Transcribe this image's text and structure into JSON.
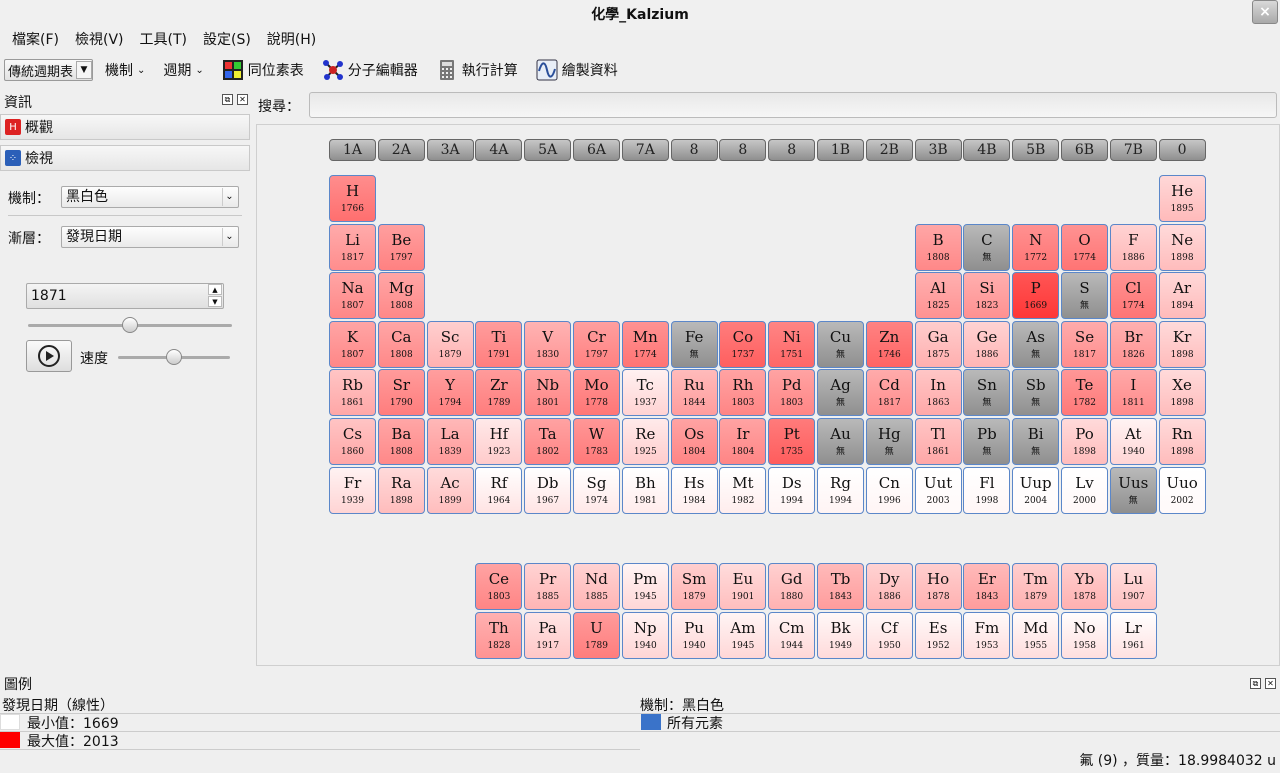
{
  "window": {
    "title": "化學_Kalzium",
    "close_glyph": "×"
  },
  "menu": [
    "檔案(F)",
    "檢視(V)",
    "工具(T)",
    "設定(S)",
    "說明(H)"
  ],
  "toolbar": {
    "table_type": "傳統週期表",
    "scheme": "機制",
    "period": "週期",
    "isotopes": "同位素表",
    "molecule_editor": "分子編輯器",
    "calculator": "執行計算",
    "plot": "繪製資料"
  },
  "info_panel": {
    "title": "資訊",
    "overview": "概觀",
    "view": "檢視",
    "scheme_label": "機制：",
    "scheme_value": "黑白色",
    "gradient_label": "漸層：",
    "gradient_value": "發現日期",
    "year_value": "1871",
    "year_slider_fraction": 0.5,
    "speed_label": "速度",
    "speed_slider_fraction": 0.5
  },
  "search": {
    "label": "搜尋：",
    "value": ""
  },
  "group_headers": [
    "1A",
    "2A",
    "3A",
    "4A",
    "5A",
    "6A",
    "7A",
    "8",
    "8",
    "8",
    "1B",
    "2B",
    "3B",
    "4B",
    "5B",
    "6B",
    "7B",
    "0"
  ],
  "elements": [
    {
      "s": "H",
      "y": "1766",
      "c": 1,
      "r": 1,
      "k": "r"
    },
    {
      "s": "He",
      "y": "1895",
      "c": 18,
      "r": 1,
      "k": "r"
    },
    {
      "s": "Li",
      "y": "1817",
      "c": 1,
      "r": 2,
      "k": "r"
    },
    {
      "s": "Be",
      "y": "1797",
      "c": 2,
      "r": 2,
      "k": "r"
    },
    {
      "s": "B",
      "y": "1808",
      "c": 13,
      "r": 2,
      "k": "r"
    },
    {
      "s": "C",
      "y": "無",
      "c": 14,
      "r": 2,
      "k": "g"
    },
    {
      "s": "N",
      "y": "1772",
      "c": 15,
      "r": 2,
      "k": "r"
    },
    {
      "s": "O",
      "y": "1774",
      "c": 16,
      "r": 2,
      "k": "r"
    },
    {
      "s": "F",
      "y": "1886",
      "c": 17,
      "r": 2,
      "k": "r"
    },
    {
      "s": "Ne",
      "y": "1898",
      "c": 18,
      "r": 2,
      "k": "r"
    },
    {
      "s": "Na",
      "y": "1807",
      "c": 1,
      "r": 3,
      "k": "r"
    },
    {
      "s": "Mg",
      "y": "1808",
      "c": 2,
      "r": 3,
      "k": "r"
    },
    {
      "s": "Al",
      "y": "1825",
      "c": 13,
      "r": 3,
      "k": "r"
    },
    {
      "s": "Si",
      "y": "1823",
      "c": 14,
      "r": 3,
      "k": "r"
    },
    {
      "s": "P",
      "y": "1669",
      "c": 15,
      "r": 3,
      "k": "r"
    },
    {
      "s": "S",
      "y": "無",
      "c": 16,
      "r": 3,
      "k": "g"
    },
    {
      "s": "Cl",
      "y": "1774",
      "c": 17,
      "r": 3,
      "k": "r"
    },
    {
      "s": "Ar",
      "y": "1894",
      "c": 18,
      "r": 3,
      "k": "r"
    },
    {
      "s": "K",
      "y": "1807",
      "c": 1,
      "r": 4,
      "k": "r"
    },
    {
      "s": "Ca",
      "y": "1808",
      "c": 2,
      "r": 4,
      "k": "r"
    },
    {
      "s": "Sc",
      "y": "1879",
      "c": 3,
      "r": 4,
      "k": "r"
    },
    {
      "s": "Ti",
      "y": "1791",
      "c": 4,
      "r": 4,
      "k": "r"
    },
    {
      "s": "V",
      "y": "1830",
      "c": 5,
      "r": 4,
      "k": "r"
    },
    {
      "s": "Cr",
      "y": "1797",
      "c": 6,
      "r": 4,
      "k": "r"
    },
    {
      "s": "Mn",
      "y": "1774",
      "c": 7,
      "r": 4,
      "k": "r"
    },
    {
      "s": "Fe",
      "y": "無",
      "c": 8,
      "r": 4,
      "k": "g"
    },
    {
      "s": "Co",
      "y": "1737",
      "c": 9,
      "r": 4,
      "k": "r"
    },
    {
      "s": "Ni",
      "y": "1751",
      "c": 10,
      "r": 4,
      "k": "r"
    },
    {
      "s": "Cu",
      "y": "無",
      "c": 11,
      "r": 4,
      "k": "g"
    },
    {
      "s": "Zn",
      "y": "1746",
      "c": 12,
      "r": 4,
      "k": "r"
    },
    {
      "s": "Ga",
      "y": "1875",
      "c": 13,
      "r": 4,
      "k": "r"
    },
    {
      "s": "Ge",
      "y": "1886",
      "c": 14,
      "r": 4,
      "k": "r"
    },
    {
      "s": "As",
      "y": "無",
      "c": 15,
      "r": 4,
      "k": "g"
    },
    {
      "s": "Se",
      "y": "1817",
      "c": 16,
      "r": 4,
      "k": "r"
    },
    {
      "s": "Br",
      "y": "1826",
      "c": 17,
      "r": 4,
      "k": "r"
    },
    {
      "s": "Kr",
      "y": "1898",
      "c": 18,
      "r": 4,
      "k": "r"
    },
    {
      "s": "Rb",
      "y": "1861",
      "c": 1,
      "r": 5,
      "k": "r"
    },
    {
      "s": "Sr",
      "y": "1790",
      "c": 2,
      "r": 5,
      "k": "r"
    },
    {
      "s": "Y",
      "y": "1794",
      "c": 3,
      "r": 5,
      "k": "r"
    },
    {
      "s": "Zr",
      "y": "1789",
      "c": 4,
      "r": 5,
      "k": "r"
    },
    {
      "s": "Nb",
      "y": "1801",
      "c": 5,
      "r": 5,
      "k": "r"
    },
    {
      "s": "Mo",
      "y": "1778",
      "c": 6,
      "r": 5,
      "k": "r"
    },
    {
      "s": "Tc",
      "y": "1937",
      "c": 7,
      "r": 5,
      "k": "r"
    },
    {
      "s": "Ru",
      "y": "1844",
      "c": 8,
      "r": 5,
      "k": "r"
    },
    {
      "s": "Rh",
      "y": "1803",
      "c": 9,
      "r": 5,
      "k": "r"
    },
    {
      "s": "Pd",
      "y": "1803",
      "c": 10,
      "r": 5,
      "k": "r"
    },
    {
      "s": "Ag",
      "y": "無",
      "c": 11,
      "r": 5,
      "k": "g"
    },
    {
      "s": "Cd",
      "y": "1817",
      "c": 12,
      "r": 5,
      "k": "r"
    },
    {
      "s": "In",
      "y": "1863",
      "c": 13,
      "r": 5,
      "k": "r"
    },
    {
      "s": "Sn",
      "y": "無",
      "c": 14,
      "r": 5,
      "k": "g"
    },
    {
      "s": "Sb",
      "y": "無",
      "c": 15,
      "r": 5,
      "k": "g"
    },
    {
      "s": "Te",
      "y": "1782",
      "c": 16,
      "r": 5,
      "k": "r"
    },
    {
      "s": "I",
      "y": "1811",
      "c": 17,
      "r": 5,
      "k": "r"
    },
    {
      "s": "Xe",
      "y": "1898",
      "c": 18,
      "r": 5,
      "k": "r"
    },
    {
      "s": "Cs",
      "y": "1860",
      "c": 1,
      "r": 6,
      "k": "r"
    },
    {
      "s": "Ba",
      "y": "1808",
      "c": 2,
      "r": 6,
      "k": "r"
    },
    {
      "s": "La",
      "y": "1839",
      "c": 3,
      "r": 6,
      "k": "r"
    },
    {
      "s": "Hf",
      "y": "1923",
      "c": 4,
      "r": 6,
      "k": "r"
    },
    {
      "s": "Ta",
      "y": "1802",
      "c": 5,
      "r": 6,
      "k": "r"
    },
    {
      "s": "W",
      "y": "1783",
      "c": 6,
      "r": 6,
      "k": "r"
    },
    {
      "s": "Re",
      "y": "1925",
      "c": 7,
      "r": 6,
      "k": "r"
    },
    {
      "s": "Os",
      "y": "1804",
      "c": 8,
      "r": 6,
      "k": "r"
    },
    {
      "s": "Ir",
      "y": "1804",
      "c": 9,
      "r": 6,
      "k": "r"
    },
    {
      "s": "Pt",
      "y": "1735",
      "c": 10,
      "r": 6,
      "k": "r"
    },
    {
      "s": "Au",
      "y": "無",
      "c": 11,
      "r": 6,
      "k": "g"
    },
    {
      "s": "Hg",
      "y": "無",
      "c": 12,
      "r": 6,
      "k": "g"
    },
    {
      "s": "Tl",
      "y": "1861",
      "c": 13,
      "r": 6,
      "k": "r"
    },
    {
      "s": "Pb",
      "y": "無",
      "c": 14,
      "r": 6,
      "k": "g"
    },
    {
      "s": "Bi",
      "y": "無",
      "c": 15,
      "r": 6,
      "k": "g"
    },
    {
      "s": "Po",
      "y": "1898",
      "c": 16,
      "r": 6,
      "k": "r"
    },
    {
      "s": "At",
      "y": "1940",
      "c": 17,
      "r": 6,
      "k": "r"
    },
    {
      "s": "Rn",
      "y": "1898",
      "c": 18,
      "r": 6,
      "k": "r"
    },
    {
      "s": "Fr",
      "y": "1939",
      "c": 1,
      "r": 7,
      "k": "r"
    },
    {
      "s": "Ra",
      "y": "1898",
      "c": 2,
      "r": 7,
      "k": "r"
    },
    {
      "s": "Ac",
      "y": "1899",
      "c": 3,
      "r": 7,
      "k": "r"
    },
    {
      "s": "Rf",
      "y": "1964",
      "c": 4,
      "r": 7,
      "k": "r"
    },
    {
      "s": "Db",
      "y": "1967",
      "c": 5,
      "r": 7,
      "k": "r"
    },
    {
      "s": "Sg",
      "y": "1974",
      "c": 6,
      "r": 7,
      "k": "r"
    },
    {
      "s": "Bh",
      "y": "1981",
      "c": 7,
      "r": 7,
      "k": "r"
    },
    {
      "s": "Hs",
      "y": "1984",
      "c": 8,
      "r": 7,
      "k": "r"
    },
    {
      "s": "Mt",
      "y": "1982",
      "c": 9,
      "r": 7,
      "k": "r"
    },
    {
      "s": "Ds",
      "y": "1994",
      "c": 10,
      "r": 7,
      "k": "r"
    },
    {
      "s": "Rg",
      "y": "1994",
      "c": 11,
      "r": 7,
      "k": "r"
    },
    {
      "s": "Cn",
      "y": "1996",
      "c": 12,
      "r": 7,
      "k": "r"
    },
    {
      "s": "Uut",
      "y": "2003",
      "c": 13,
      "r": 7,
      "k": "r"
    },
    {
      "s": "Fl",
      "y": "1998",
      "c": 14,
      "r": 7,
      "k": "r"
    },
    {
      "s": "Uup",
      "y": "2004",
      "c": 15,
      "r": 7,
      "k": "r"
    },
    {
      "s": "Lv",
      "y": "2000",
      "c": 16,
      "r": 7,
      "k": "r"
    },
    {
      "s": "Uus",
      "y": "無",
      "c": 17,
      "r": 7,
      "k": "g"
    },
    {
      "s": "Uuo",
      "y": "2002",
      "c": 18,
      "r": 7,
      "k": "r"
    },
    {
      "s": "Ce",
      "y": "1803",
      "c": 4,
      "r": 9,
      "k": "r"
    },
    {
      "s": "Pr",
      "y": "1885",
      "c": 5,
      "r": 9,
      "k": "r"
    },
    {
      "s": "Nd",
      "y": "1885",
      "c": 6,
      "r": 9,
      "k": "r"
    },
    {
      "s": "Pm",
      "y": "1945",
      "c": 7,
      "r": 9,
      "k": "r"
    },
    {
      "s": "Sm",
      "y": "1879",
      "c": 8,
      "r": 9,
      "k": "r"
    },
    {
      "s": "Eu",
      "y": "1901",
      "c": 9,
      "r": 9,
      "k": "r"
    },
    {
      "s": "Gd",
      "y": "1880",
      "c": 10,
      "r": 9,
      "k": "r"
    },
    {
      "s": "Tb",
      "y": "1843",
      "c": 11,
      "r": 9,
      "k": "r"
    },
    {
      "s": "Dy",
      "y": "1886",
      "c": 12,
      "r": 9,
      "k": "r"
    },
    {
      "s": "Ho",
      "y": "1878",
      "c": 13,
      "r": 9,
      "k": "r"
    },
    {
      "s": "Er",
      "y": "1843",
      "c": 14,
      "r": 9,
      "k": "r"
    },
    {
      "s": "Tm",
      "y": "1879",
      "c": 15,
      "r": 9,
      "k": "r"
    },
    {
      "s": "Yb",
      "y": "1878",
      "c": 16,
      "r": 9,
      "k": "r"
    },
    {
      "s": "Lu",
      "y": "1907",
      "c": 17,
      "r": 9,
      "k": "r"
    },
    {
      "s": "Th",
      "y": "1828",
      "c": 4,
      "r": 10,
      "k": "r"
    },
    {
      "s": "Pa",
      "y": "1917",
      "c": 5,
      "r": 10,
      "k": "r"
    },
    {
      "s": "U",
      "y": "1789",
      "c": 6,
      "r": 10,
      "k": "r"
    },
    {
      "s": "Np",
      "y": "1940",
      "c": 7,
      "r": 10,
      "k": "r"
    },
    {
      "s": "Pu",
      "y": "1940",
      "c": 8,
      "r": 10,
      "k": "r"
    },
    {
      "s": "Am",
      "y": "1945",
      "c": 9,
      "r": 10,
      "k": "r"
    },
    {
      "s": "Cm",
      "y": "1944",
      "c": 10,
      "r": 10,
      "k": "r"
    },
    {
      "s": "Bk",
      "y": "1949",
      "c": 11,
      "r": 10,
      "k": "r"
    },
    {
      "s": "Cf",
      "y": "1950",
      "c": 12,
      "r": 10,
      "k": "r"
    },
    {
      "s": "Es",
      "y": "1952",
      "c": 13,
      "r": 10,
      "k": "r"
    },
    {
      "s": "Fm",
      "y": "1953",
      "c": 14,
      "r": 10,
      "k": "r"
    },
    {
      "s": "Md",
      "y": "1955",
      "c": 15,
      "r": 10,
      "k": "r"
    },
    {
      "s": "No",
      "y": "1958",
      "c": 16,
      "r": 10,
      "k": "r"
    },
    {
      "s": "Lr",
      "y": "1961",
      "c": 17,
      "r": 10,
      "k": "r"
    }
  ],
  "legend": {
    "title": "圖例",
    "gradient_title": "發現日期（線性）",
    "min_label": "最小值：1669",
    "max_label": "最大值：2013",
    "min_color": "#ffffff",
    "max_color": "#ff0000",
    "min_year": 1669,
    "max_year": 2013,
    "scheme_title": "機制：黑白色",
    "all_elements": "所有元素",
    "all_color": "#3a73c9",
    "unknown_color": "#8f8f8f"
  },
  "status": "氟 (9) ，質量：18.9984032 u"
}
